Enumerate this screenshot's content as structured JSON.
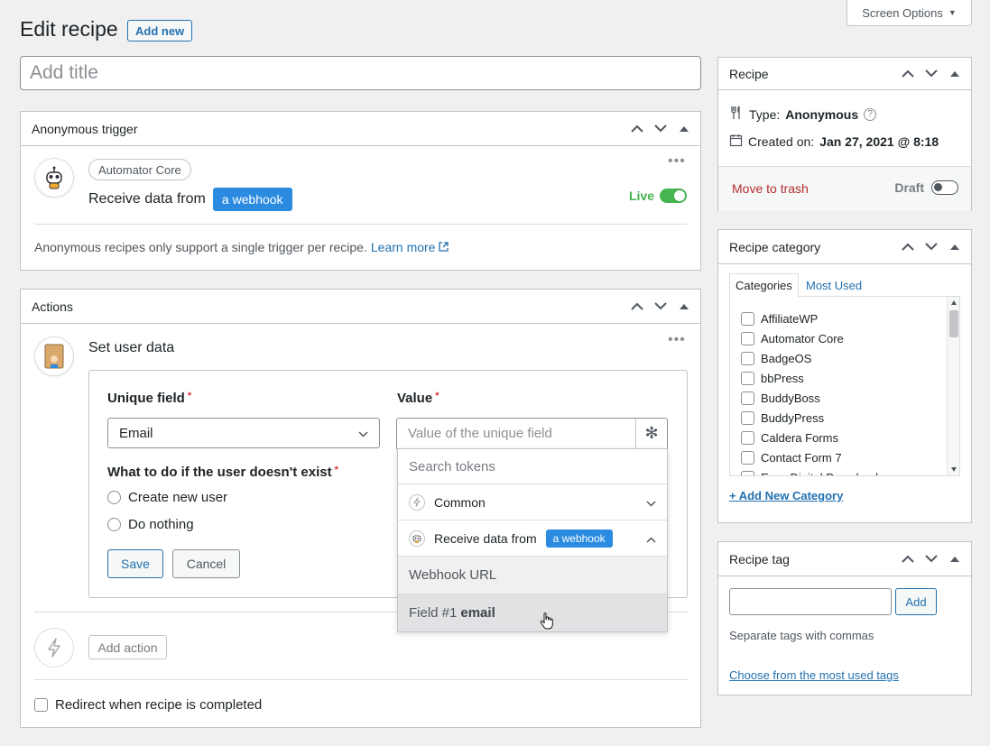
{
  "header": {
    "screen_options": "Screen Options",
    "page_title": "Edit recipe",
    "add_new": "Add new",
    "title_placeholder": "Add title"
  },
  "trigger_box": {
    "title": "Anonymous trigger",
    "integration": "Automator Core",
    "sentence": "Receive data from",
    "badge": "a webhook",
    "live_label": "Live",
    "note": "Anonymous recipes only support a single trigger per recipe.",
    "learn_more": "Learn more"
  },
  "actions_box": {
    "title": "Actions",
    "action_title": "Set user data",
    "unique_field_label": "Unique field",
    "unique_field_value": "Email",
    "value_label": "Value",
    "value_placeholder": "Value of the unique field",
    "not_exist_label": "What to do if the user doesn't exist",
    "options": [
      "Create new user",
      "Do nothing"
    ],
    "save": "Save",
    "cancel": "Cancel",
    "add_action": "Add action",
    "redirect": "Redirect when recipe is completed"
  },
  "token_dropdown": {
    "search_placeholder": "Search tokens",
    "groups": [
      {
        "label": "Common",
        "badge": ""
      },
      {
        "label": "Receive data from",
        "badge": "a webhook"
      }
    ],
    "items": [
      {
        "prefix": "Webhook URL",
        "bold": ""
      },
      {
        "prefix": "Field #1",
        "bold": "email"
      }
    ]
  },
  "recipe_box": {
    "title": "Recipe",
    "type_label": "Type:",
    "type_value": "Anonymous",
    "created_label": "Created on:",
    "created_value": "Jan 27, 2021 @ 8:18",
    "trash": "Move to trash",
    "status": "Draft"
  },
  "category_box": {
    "title": "Recipe category",
    "tabs": [
      "Categories",
      "Most Used"
    ],
    "items": [
      "AffiliateWP",
      "Automator Core",
      "BadgeOS",
      "bbPress",
      "BuddyBoss",
      "BuddyPress",
      "Caldera Forms",
      "Contact Form 7",
      "Easy Digital Downloads"
    ],
    "add_new": "+ Add New Category"
  },
  "tag_box": {
    "title": "Recipe tag",
    "add": "Add",
    "hint": "Separate tags with commas",
    "choose": "Choose from the most used tags"
  },
  "colors": {
    "accent": "#2271b1",
    "badge": "#2a8be0",
    "live": "#46b450",
    "trash": "#b32d2e"
  }
}
